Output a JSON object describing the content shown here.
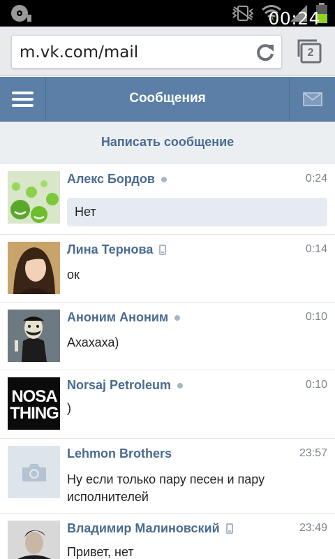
{
  "status_bar": {
    "time": "00:24",
    "left_icon": "cd-icon",
    "icons": [
      "vibrate-icon",
      "wifi-icon",
      "signal-icon",
      "battery-icon"
    ]
  },
  "browser": {
    "url": "m.vk.com/mail",
    "tab_count": "2"
  },
  "header": {
    "title": "Сообщения"
  },
  "compose": {
    "label": "Написать сообщение"
  },
  "dialogs": [
    {
      "name": "Алекс Бордов",
      "presence": "online",
      "time": "0:24",
      "snippet": "Нет",
      "unread": true
    },
    {
      "name": "Лина Тернова",
      "presence": "mobile",
      "time": "0:14",
      "snippet": "ок",
      "unread": false
    },
    {
      "name": "Аноним Аноним",
      "presence": "online",
      "time": "0:10",
      "snippet": "Ахахаха)",
      "unread": false
    },
    {
      "name": "Norsaj Petroleum",
      "presence": "online",
      "time": "0:10",
      "snippet": ")",
      "unread": false,
      "avatar_text_1": "NOSA",
      "avatar_text_2": "THING"
    },
    {
      "name": "Lehmon Brothers",
      "presence": "none",
      "time": "23:57",
      "snippet": "Ну если только пару песен и пару исполнителей",
      "unread": false
    },
    {
      "name": "Владимир Малиновский",
      "presence": "mobile",
      "time": "23:49",
      "snippet": "Привет, нет",
      "unread": false
    }
  ],
  "colors": {
    "vk_blue": "#5b7fa7",
    "link_blue": "#4a6b91",
    "unread_bg": "#e6ebf1"
  }
}
